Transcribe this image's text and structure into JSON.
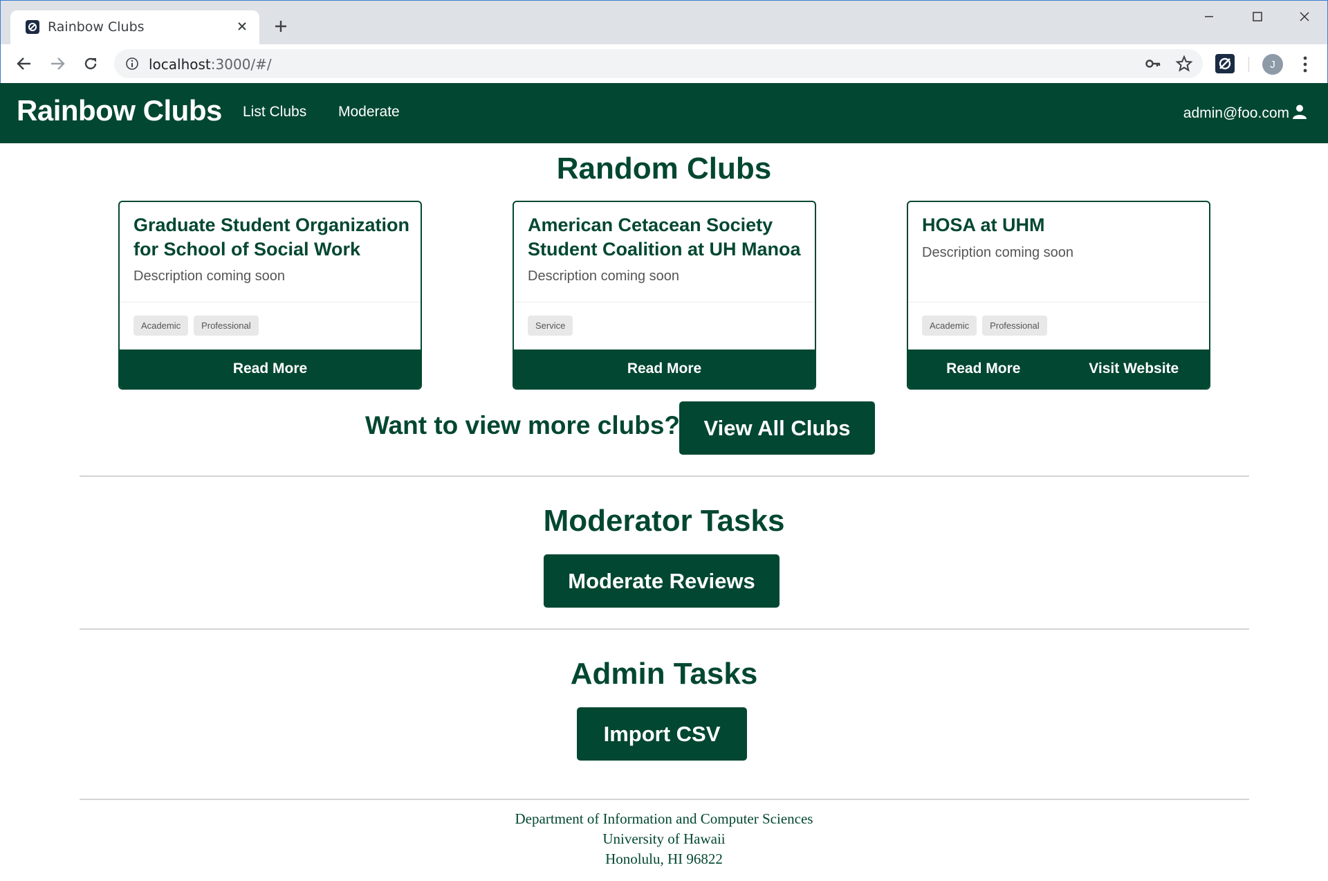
{
  "browser": {
    "tab_title": "Rainbow Clubs",
    "url_host": "localhost",
    "url_rest": ":3000/#/",
    "profile_initial": "J"
  },
  "navbar": {
    "brand": "Rainbow Clubs",
    "links": [
      "List Clubs",
      "Moderate"
    ],
    "user": "admin@foo.com"
  },
  "random_clubs": {
    "heading": "Random Clubs",
    "cards": [
      {
        "title": "Graduate Student Organization for School of Social Work",
        "description": "Description coming soon",
        "labels": [
          "Academic",
          "Professional"
        ],
        "buttons": [
          "Read More"
        ]
      },
      {
        "title": "American Cetacean Society Student Coalition at UH Manoa",
        "description": "Description coming soon",
        "labels": [
          "Service"
        ],
        "buttons": [
          "Read More"
        ]
      },
      {
        "title": "HOSA at UHM",
        "description": "Description coming soon",
        "labels": [
          "Academic",
          "Professional"
        ],
        "buttons": [
          "Read More",
          "Visit Website"
        ]
      }
    ],
    "more_prompt": "Want to view more clubs?",
    "view_all_label": "View All Clubs"
  },
  "moderator": {
    "heading": "Moderator Tasks",
    "button": "Moderate Reviews"
  },
  "admin": {
    "heading": "Admin Tasks",
    "button": "Import CSV"
  },
  "footer": {
    "lines": [
      "Department of Information and Computer Sciences",
      "University of Hawaii",
      "Honolulu, HI 96822"
    ]
  },
  "colors": {
    "primary": "#024731",
    "label_bg": "#e8e8e8"
  }
}
